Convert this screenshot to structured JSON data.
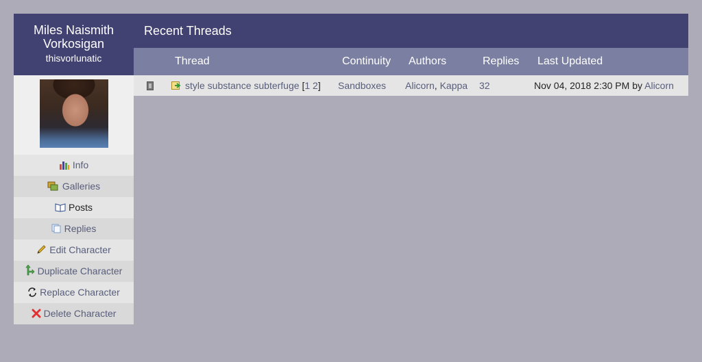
{
  "character": {
    "name": "Miles Naismith Vorkosigan",
    "screenname": "thisvorlunatic"
  },
  "menu": [
    {
      "label": "Info",
      "icon": "bar-chart-icon"
    },
    {
      "label": "Galleries",
      "icon": "galleries-icon"
    },
    {
      "label": "Posts",
      "icon": "book-icon"
    },
    {
      "label": "Replies",
      "icon": "replies-icon"
    },
    {
      "label": "Edit Character",
      "icon": "pencil-icon"
    },
    {
      "label": "Duplicate Character",
      "icon": "duplicate-icon"
    },
    {
      "label": "Replace Character",
      "icon": "refresh-icon"
    },
    {
      "label": "Delete Character",
      "icon": "delete-x-icon"
    }
  ],
  "main": {
    "title": "Recent Threads",
    "columns": [
      "Thread",
      "Continuity",
      "Authors",
      "Replies",
      "Last Updated"
    ],
    "rows": [
      {
        "thread": "style substance subterfuge",
        "pages": [
          "1",
          "2"
        ],
        "continuity": "Sandboxes",
        "authors": [
          "Alicorn",
          "Kappa"
        ],
        "replies": "32",
        "last_updated": "Nov 04, 2018 2:30 PM",
        "by_word": "by",
        "last_author": "Alicorn"
      }
    ]
  },
  "colors": {
    "header_bg": "#414172",
    "table_header_bg": "#7b7fa1",
    "page_bg": "#aeabb8",
    "link": "#575d7a"
  }
}
